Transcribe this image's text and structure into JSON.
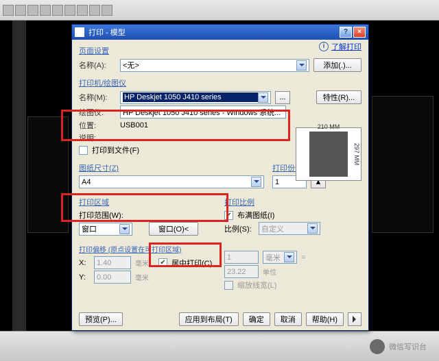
{
  "window": {
    "title": "打印 - 模型"
  },
  "learn_link": "了解打印",
  "page_setup": {
    "title": "页面设置",
    "name_label": "名称(A):",
    "name_value": "<无>",
    "add_btn": "添加(.)..."
  },
  "printer": {
    "title": "打印机/绘图仪",
    "name_label": "名称(M):",
    "name_value": "HP Deskjet 1050 J410 series",
    "props_btn": "特性(R)...",
    "plotter_label": "绘图仪:",
    "plotter_value": "HP Deskjet 1050 J410 series - Windows 系统...",
    "location_label": "位置:",
    "location_value": "USB001",
    "desc_label": "说明:",
    "to_file_checkbox": "打印到文件(F)"
  },
  "preview": {
    "width": "210 MM",
    "height": "297 MM"
  },
  "paper": {
    "title": "图纸尺寸(Z)",
    "value": "A4"
  },
  "copies": {
    "title": "打印份数(B)",
    "value": "1"
  },
  "area": {
    "title": "打印区域",
    "range_label": "打印范围(W):",
    "range_value": "窗口",
    "window_btn": "窗口(O)<"
  },
  "scale": {
    "title": "打印比例",
    "fit_checkbox": "布满图纸(I)",
    "fit_checked": true,
    "scale_label": "比例(S):",
    "scale_value": "自定义",
    "num1": "1",
    "unit1": "毫米",
    "num2": "23.22",
    "unit2": "单位",
    "lineweight_checkbox": "缩放线宽(L)"
  },
  "offset": {
    "title": "打印偏移 (原点设置在可打印区域)",
    "x_label": "X:",
    "x_value": "1.40",
    "x_unit": "毫米",
    "y_label": "Y:",
    "y_value": "0.00",
    "y_unit": "毫米",
    "center_checkbox": "居中打印(C)",
    "center_checked": true
  },
  "buttons": {
    "preview": "预览(P)...",
    "apply": "应用到布局(T)",
    "ok": "确定",
    "cancel": "取消",
    "help": "帮助(H)"
  },
  "watermark": "微信写识台"
}
